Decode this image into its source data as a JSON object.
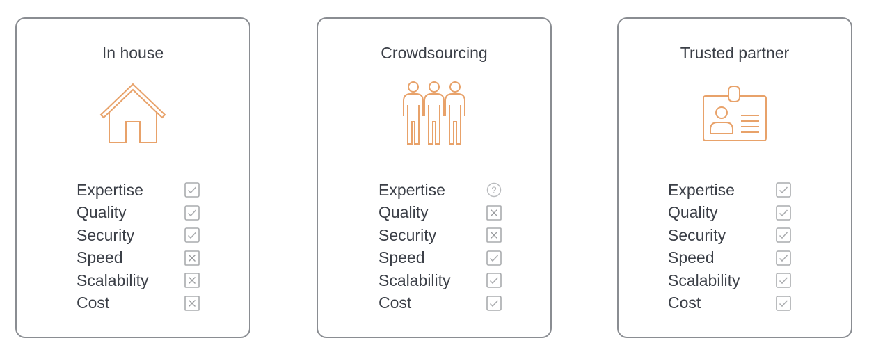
{
  "accent_color": "#e8a26a",
  "cards": [
    {
      "title": "In house",
      "icon": "house-icon",
      "criteria": [
        {
          "label": "Expertise",
          "status": "check"
        },
        {
          "label": "Quality",
          "status": "check"
        },
        {
          "label": "Security",
          "status": "check"
        },
        {
          "label": "Speed",
          "status": "cross"
        },
        {
          "label": "Scalability",
          "status": "cross"
        },
        {
          "label": "Cost",
          "status": "cross"
        }
      ]
    },
    {
      "title": "Crowdsourcing",
      "icon": "people-group-icon",
      "criteria": [
        {
          "label": "Expertise",
          "status": "question"
        },
        {
          "label": "Quality",
          "status": "cross"
        },
        {
          "label": "Security",
          "status": "cross"
        },
        {
          "label": "Speed",
          "status": "check"
        },
        {
          "label": "Scalability",
          "status": "check"
        },
        {
          "label": "Cost",
          "status": "check"
        }
      ]
    },
    {
      "title": "Trusted partner",
      "icon": "id-badge-icon",
      "criteria": [
        {
          "label": "Expertise",
          "status": "check"
        },
        {
          "label": "Quality",
          "status": "check"
        },
        {
          "label": "Security",
          "status": "check"
        },
        {
          "label": "Speed",
          "status": "check"
        },
        {
          "label": "Scalability",
          "status": "check"
        },
        {
          "label": "Cost",
          "status": "check"
        }
      ]
    }
  ]
}
